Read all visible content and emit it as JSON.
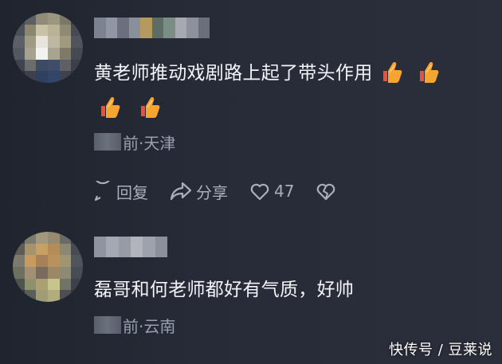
{
  "comments": [
    {
      "text": "黄老师推动戏剧路上起了带头作用",
      "emoji": [
        "thumbs-up",
        "thumbs-up",
        "thumbs-up",
        "thumbs-up"
      ],
      "meta_suffix": "前·天津",
      "actions": {
        "reply": "回复",
        "share": "分享",
        "likes": "47"
      }
    },
    {
      "text": "磊哥和何老师都好有气质，好帅",
      "meta_suffix": "前·云南"
    }
  ],
  "watermark": "快传号 / 豆莱说",
  "colors": {
    "background": "#262a36",
    "text": "#f3f4f8",
    "muted": "#9aa0ae",
    "thumb": "#f7a531"
  }
}
